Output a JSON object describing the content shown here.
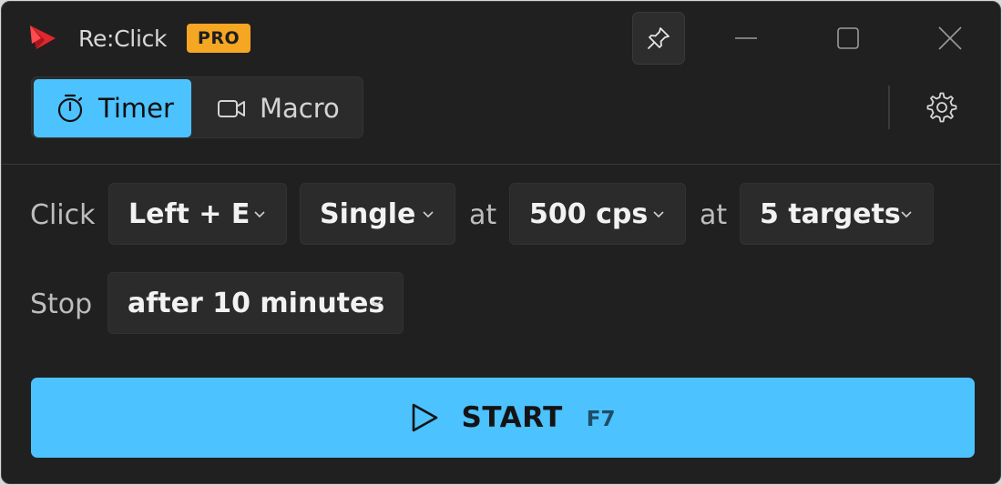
{
  "titlebar": {
    "app_name": "Re:Click",
    "badge": "PRO",
    "icons": [
      "pin-icon",
      "minimize-icon",
      "maximize-icon",
      "close-icon"
    ]
  },
  "modes": {
    "tabs": [
      {
        "label": "Timer",
        "icon": "stopwatch-icon",
        "active": true
      },
      {
        "label": "Macro",
        "icon": "video-camera-icon",
        "active": false
      }
    ],
    "settings_icon": "gear-icon"
  },
  "click_row": {
    "label": "Click",
    "button": "Left + E",
    "type": "Single",
    "at1": "at",
    "rate": "500 cps",
    "at2": "at",
    "targets": "5 targets"
  },
  "stop_row": {
    "label": "Stop",
    "condition": "after 10 minutes"
  },
  "start": {
    "label": "START",
    "hotkey": "F7",
    "icon": "play-icon"
  },
  "colors": {
    "accent": "#4cc2ff",
    "badge": "#f5a623",
    "logo": "#e0262e",
    "background": "#202020",
    "control": "#2b2b2b"
  }
}
